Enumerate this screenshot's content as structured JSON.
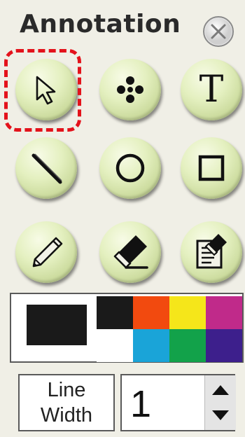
{
  "header": {
    "title": "Annotation",
    "close_icon": "close-icon"
  },
  "tools": [
    {
      "id": "select",
      "icon": "cursor-arrow-icon",
      "selected": true
    },
    {
      "id": "move",
      "icon": "four-dots-icon"
    },
    {
      "id": "text",
      "icon": "text-icon",
      "glyph": "T"
    },
    {
      "id": "line",
      "icon": "line-icon"
    },
    {
      "id": "ellipse",
      "icon": "circle-icon"
    },
    {
      "id": "rectangle",
      "icon": "square-icon"
    },
    {
      "id": "pen",
      "icon": "pencil-icon"
    },
    {
      "id": "eraser",
      "icon": "eraser-icon"
    },
    {
      "id": "clear",
      "icon": "clipboard-eraser-icon"
    }
  ],
  "colors": {
    "current": "#1a1a1a",
    "palette": [
      "#1a1a1a",
      "#f24a0f",
      "#f5e61a",
      "#c02a8a",
      "#ffffff",
      "#1aa4d8",
      "#12a24a",
      "#3d1f8c"
    ],
    "selection_outline": "#e3121b",
    "button_face": "#e4f0c0"
  },
  "line_width": {
    "label_line1": "Line",
    "label_line2": "Width",
    "value": "1"
  }
}
